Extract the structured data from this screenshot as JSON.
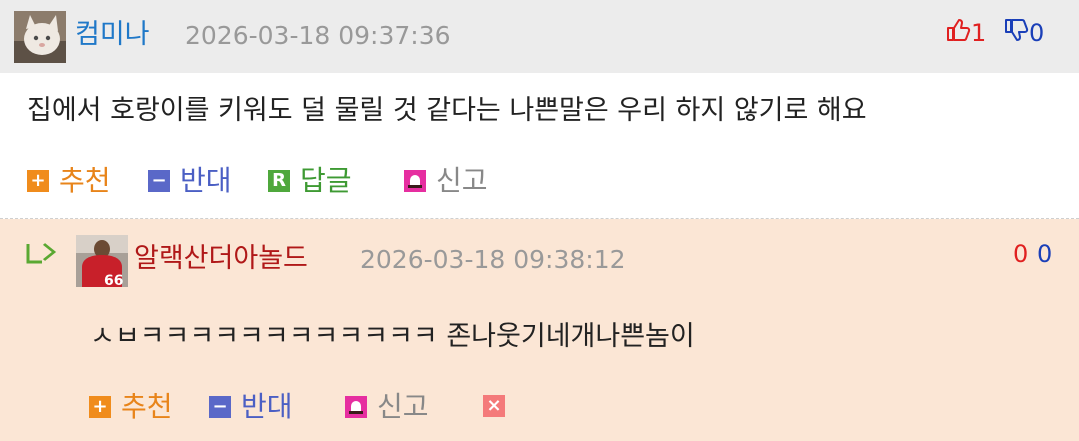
{
  "comments": [
    {
      "author": "컴미나",
      "timestamp": "2026-03-18 09:37:36",
      "text": "집에서 호랑이를 키워도 덜 물릴 것 같다는 나쁜말은 우리 하지 않기로 해요",
      "likes": "1",
      "dislikes": "0",
      "actions": {
        "recommend": "추천",
        "oppose": "반대",
        "reply": "답글",
        "report": "신고"
      },
      "colors": {
        "author": "#1f78c8",
        "like": "#e02020",
        "dislike": "#1a3fb8"
      }
    },
    {
      "author": "알랙산더아놀드",
      "timestamp": "2026-03-18 09:38:12",
      "text": "ㅅㅂㅋㅋㅋㅋㅋㅋㅋㅋㅋㅋㅋㅋ 존나웃기네개나쁜놈이",
      "likes": "0",
      "dislikes": "0",
      "actions": {
        "recommend": "추천",
        "oppose": "반대",
        "report": "신고"
      },
      "colors": {
        "author": "#b01818",
        "like": "#e02020",
        "dislike": "#1a3fb8"
      }
    }
  ],
  "icons": {
    "reply_arrow": "reply-arrow-icon",
    "thumbs_up": "thumbs-up-icon",
    "thumbs_down": "thumbs-down-icon",
    "recommend": "plus-icon",
    "oppose": "minus-icon",
    "reply": "reply-r-icon",
    "report": "siren-icon",
    "delete": "close-icon"
  },
  "accent_colors": {
    "recommend": "#f08c1c",
    "oppose": "#5a68c8",
    "reply": "#4fa83c",
    "report": "#e62ea0",
    "delete": "#f47a7a",
    "reply_background": "#fbe6d5",
    "header_background": "#ececec"
  }
}
